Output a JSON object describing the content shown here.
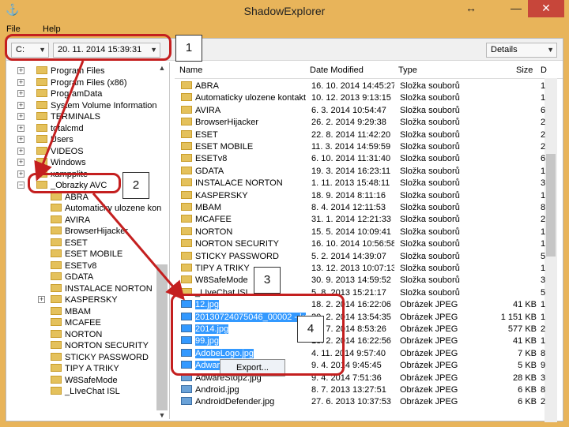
{
  "window": {
    "title": "ShadowExplorer",
    "restore_glyph": "↔",
    "min_glyph": "—",
    "close_glyph": "✕"
  },
  "menu": [
    "File",
    "Help"
  ],
  "toolbar": {
    "drive": "C:",
    "snapshot": "20. 11. 2014 15:39:31",
    "view": "Details"
  },
  "tree": [
    "Program Files",
    "Program Files (x86)",
    "ProgramData",
    "System Volume Information",
    "TERMINALS",
    "totalcmd",
    "Users",
    "VIDEOS",
    "Windows",
    "xampplite",
    "_Obrazky AVC",
    "ABRA",
    "Automaticky ulozene kon",
    "AVIRA",
    "BrowserHijacker",
    "ESET",
    "ESET MOBILE",
    "ESETv8",
    "GDATA",
    "INSTALACE NORTON",
    "KASPERSKY",
    "MBAM",
    "MCAFEE",
    "NORTON",
    "NORTON SECURITY",
    "STICKY PASSWORD",
    "TIPY A TRIKY",
    "W8SafeMode",
    "_LIveChat ISL"
  ],
  "columns": {
    "name": "Name",
    "date": "Date Modified",
    "type": "Type",
    "size": "Size",
    "tail": "D"
  },
  "files_top": [
    {
      "name": "ABRA",
      "date": "16. 10. 2014 14:45:27",
      "type": "Složka souborů",
      "tail": "1"
    },
    {
      "name": "Automaticky ulozene kontakty",
      "date": "10. 12. 2013 9:13:15",
      "type": "Složka souborů",
      "tail": "1"
    },
    {
      "name": "AVIRA",
      "date": "6. 3. 2014 10:54:47",
      "type": "Složka souborů",
      "tail": "6"
    },
    {
      "name": "BrowserHijacker",
      "date": "26. 2. 2014 9:29:38",
      "type": "Složka souborů",
      "tail": "2"
    },
    {
      "name": "ESET",
      "date": "22. 8. 2014 11:42:20",
      "type": "Složka souborů",
      "tail": "2"
    },
    {
      "name": "ESET MOBILE",
      "date": "11. 3. 2014 14:59:59",
      "type": "Složka souborů",
      "tail": "2"
    },
    {
      "name": "ESETv8",
      "date": "6. 10. 2014 11:31:40",
      "type": "Složka souborů",
      "tail": "6"
    },
    {
      "name": "GDATA",
      "date": "19. 3. 2014 16:23:11",
      "type": "Složka souborů",
      "tail": "1"
    },
    {
      "name": "INSTALACE NORTON",
      "date": "1. 11. 2013 15:48:11",
      "type": "Složka souborů",
      "tail": "3"
    },
    {
      "name": "KASPERSKY",
      "date": "18. 9. 2014 8:11:16",
      "type": "Složka souborů",
      "tail": "1"
    },
    {
      "name": "MBAM",
      "date": "8. 4. 2014 12:11:53",
      "type": "Složka souborů",
      "tail": "8"
    },
    {
      "name": "MCAFEE",
      "date": "31. 1. 2014 12:21:33",
      "type": "Složka souborů",
      "tail": "2"
    },
    {
      "name": "NORTON",
      "date": "15. 5. 2014 10:09:41",
      "type": "Složka souborů",
      "tail": "1"
    },
    {
      "name": "NORTON SECURITY",
      "date": "16. 10. 2014 10:56:58",
      "type": "Složka souborů",
      "tail": "1"
    },
    {
      "name": "STICKY PASSWORD",
      "date": "5. 2. 2014 14:39:07",
      "type": "Složka souborů",
      "tail": "5"
    },
    {
      "name": "TIPY A TRIKY",
      "date": "13. 12. 2013 10:07:13",
      "type": "Složka souborů",
      "tail": "1"
    },
    {
      "name": "W8SafeMode",
      "date": "30. 9. 2013 14:59:52",
      "type": "Složka souborů",
      "tail": "3"
    },
    {
      "name": "_LIveChat ISL",
      "date": "5. 8. 2013 15:21:17",
      "type": "Složka souborů",
      "tail": "5"
    }
  ],
  "files_bottom": [
    {
      "name": "12.jpg",
      "date": "18. 2. 2014 16:22:06",
      "type": "Obrázek JPEG",
      "size": "41 KB",
      "tail": "1",
      "selected": true
    },
    {
      "name": "20130724075046_00002 - kop",
      "date": "20. 2. 2014 13:54:35",
      "type": "Obrázek JPEG",
      "size": "1 151 KB",
      "tail": "1",
      "selected": true
    },
    {
      "name": "2014.jpg",
      "date": "23. 7. 2014 8:53:26",
      "type": "Obrázek JPEG",
      "size": "577 KB",
      "tail": "2",
      "selected": true
    },
    {
      "name": "99.jpg",
      "date": "18. 2. 2014 16:22:56",
      "type": "Obrázek JPEG",
      "size": "41 KB",
      "tail": "1",
      "selected": true
    },
    {
      "name": "AdobeLogo.jpg",
      "date": "4. 11. 2014 9:57:40",
      "type": "Obrázek JPEG",
      "size": "7 KB",
      "tail": "8",
      "selected": true
    },
    {
      "name": "AdwareStop.jpg",
      "date": "9. 4. 2014 9:45:45",
      "type": "Obrázek JPEG",
      "size": "5 KB",
      "tail": "9",
      "selected": true
    },
    {
      "name": "AdwareStop2.jpg",
      "date": "9. 4. 2014 7:51:36",
      "type": "Obrázek JPEG",
      "size": "28 KB",
      "tail": "3",
      "selected": false
    },
    {
      "name": "Android.jpg",
      "date": "8. 7. 2013 13:27:51",
      "type": "Obrázek JPEG",
      "size": "6 KB",
      "tail": "8",
      "selected": false
    },
    {
      "name": "AndroidDefender.jpg",
      "date": "27. 6. 2013 10:37:53",
      "type": "Obrázek JPEG",
      "size": "6 KB",
      "tail": "2",
      "selected": false
    }
  ],
  "context_menu": {
    "export": "Export..."
  },
  "callouts": [
    "1",
    "2",
    "3",
    "4"
  ],
  "accent_color": "#c41f1f"
}
